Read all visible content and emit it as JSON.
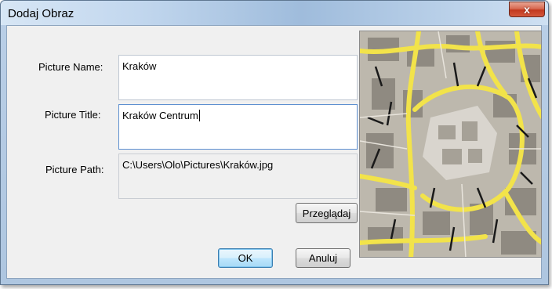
{
  "window": {
    "title": "Dodaj Obraz",
    "close_label": "x"
  },
  "form": {
    "name_label": "Picture Name:",
    "name_value": "Kraków",
    "title_label": "Picture Title:",
    "title_value": "Kraków Centrum",
    "path_label": "Picture Path:",
    "path_value": "C:\\Users\\Olo\\Pictures\\Kraków.jpg"
  },
  "buttons": {
    "browse": "Przeglądaj",
    "ok": "OK",
    "cancel": "Anuluj"
  },
  "preview": {
    "kind": "city-map-image",
    "colors": {
      "roads": "#f4e64c",
      "buildings": "#8b857c",
      "streets": "#d8d4cc"
    }
  }
}
